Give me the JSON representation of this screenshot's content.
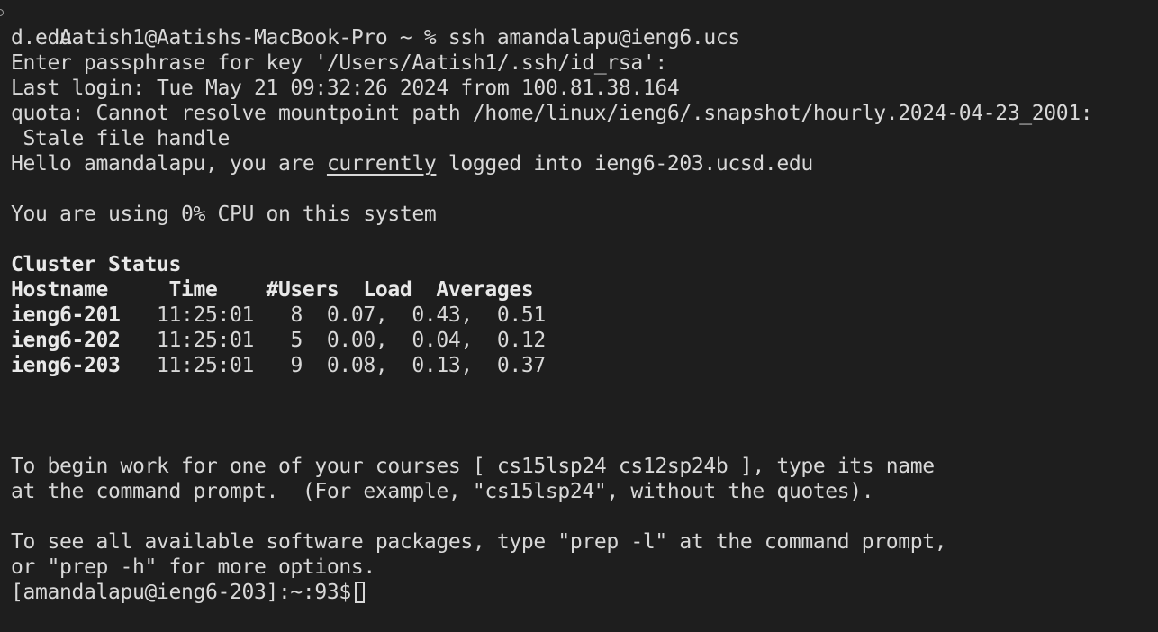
{
  "terminal": {
    "colors": {
      "background": "#1e1e1e",
      "foreground": "#d8d8d8"
    },
    "ssh_command_line": "Aatish1@Aatishs-MacBook-Pro ~ % ssh amandalapu@ieng6.ucs",
    "ssh_command_wrap": "d.edu",
    "passphrase_prompt": "Enter passphrase for key '/Users/Aatish1/.ssh/id_rsa':",
    "last_login": "Last login: Tue May 21 09:32:26 2024 from 100.81.38.164",
    "quota_warning": "quota: Cannot resolve mountpoint path /home/linux/ieng6/.snapshot/hourly.2024-04-23_2001:",
    "quota_warning_wrap": " Stale file handle",
    "hello": {
      "prefix": "Hello amandalapu, you are ",
      "underlined": "currently",
      "suffix": " logged into ieng6-203.ucsd.edu"
    },
    "cpu_usage": "You are using 0% CPU on this system",
    "cluster_status": {
      "title": "Cluster Status",
      "header": "Hostname     Time    #Users  Load  Averages",
      "rows": [
        {
          "hostname": "ieng6-201",
          "rest": "   11:25:01   8  0.07,  0.43,  0.51"
        },
        {
          "hostname": "ieng6-202",
          "rest": "   11:25:01   5  0.00,  0.04,  0.12"
        },
        {
          "hostname": "ieng6-203",
          "rest": "   11:25:01   9  0.08,  0.13,  0.37"
        }
      ]
    },
    "courses_line1": "To begin work for one of your courses [ cs15lsp24 cs12sp24b ], type its name",
    "courses_line2": "at the command prompt.  (For example, \"cs15lsp24\", without the quotes).",
    "packages_line1": "To see all available software packages, type \"prep -l\" at the command prompt,",
    "packages_line2": "or \"prep -h\" for more options.",
    "prompt": "[amandalapu@ieng6-203]:~:93$"
  }
}
